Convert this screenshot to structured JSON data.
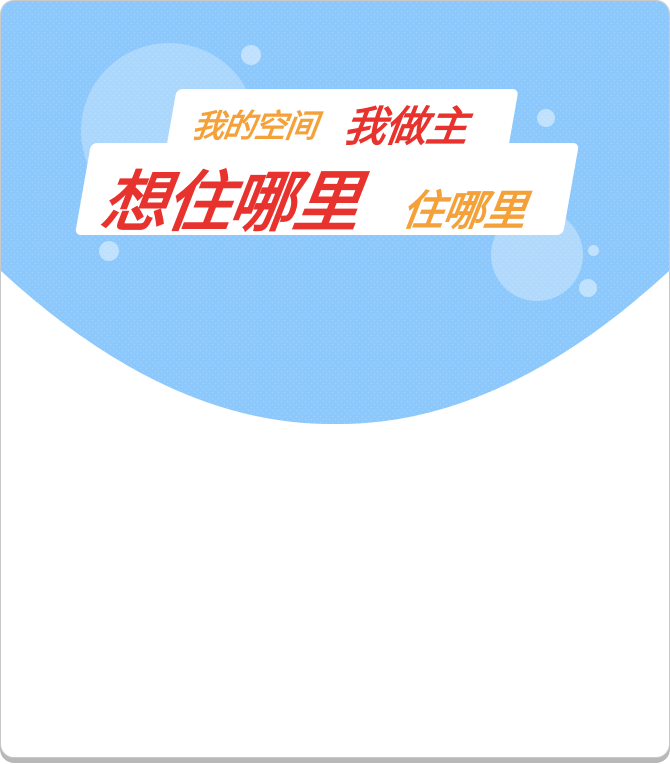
{
  "banner": {
    "line1_left": "我的空间",
    "line1_right": "我做主",
    "line2_left": "想住哪里",
    "line2_right": "住哪里"
  },
  "colors": {
    "sky_blue": "#8cc8fb",
    "headline_red": "#e8322d",
    "headline_orange": "#f5a13a",
    "card_border": "#c9c9c9"
  }
}
